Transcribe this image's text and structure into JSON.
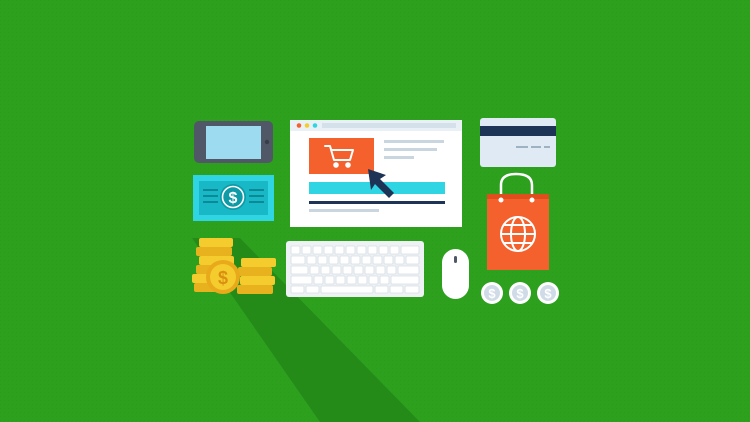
{
  "colors": {
    "background": "#2da11e",
    "shadow": "#238818",
    "accent_orange": "#f4612d",
    "accent_cyan": "#2fd5e3",
    "accent_yellow": "#f4cc2e",
    "navy": "#1d3456"
  },
  "browser": {
    "icon": "shopping-cart-icon",
    "cursor_icon": "mouse-pointer-icon",
    "window_dot_colors": [
      "#f4612d",
      "#f4cc2e",
      "#2fd5e3"
    ]
  },
  "banknote": {
    "symbol": "$"
  },
  "coins": {
    "symbol": "$",
    "small_coin_count": 3
  },
  "bag": {
    "icon": "globe-icon"
  }
}
